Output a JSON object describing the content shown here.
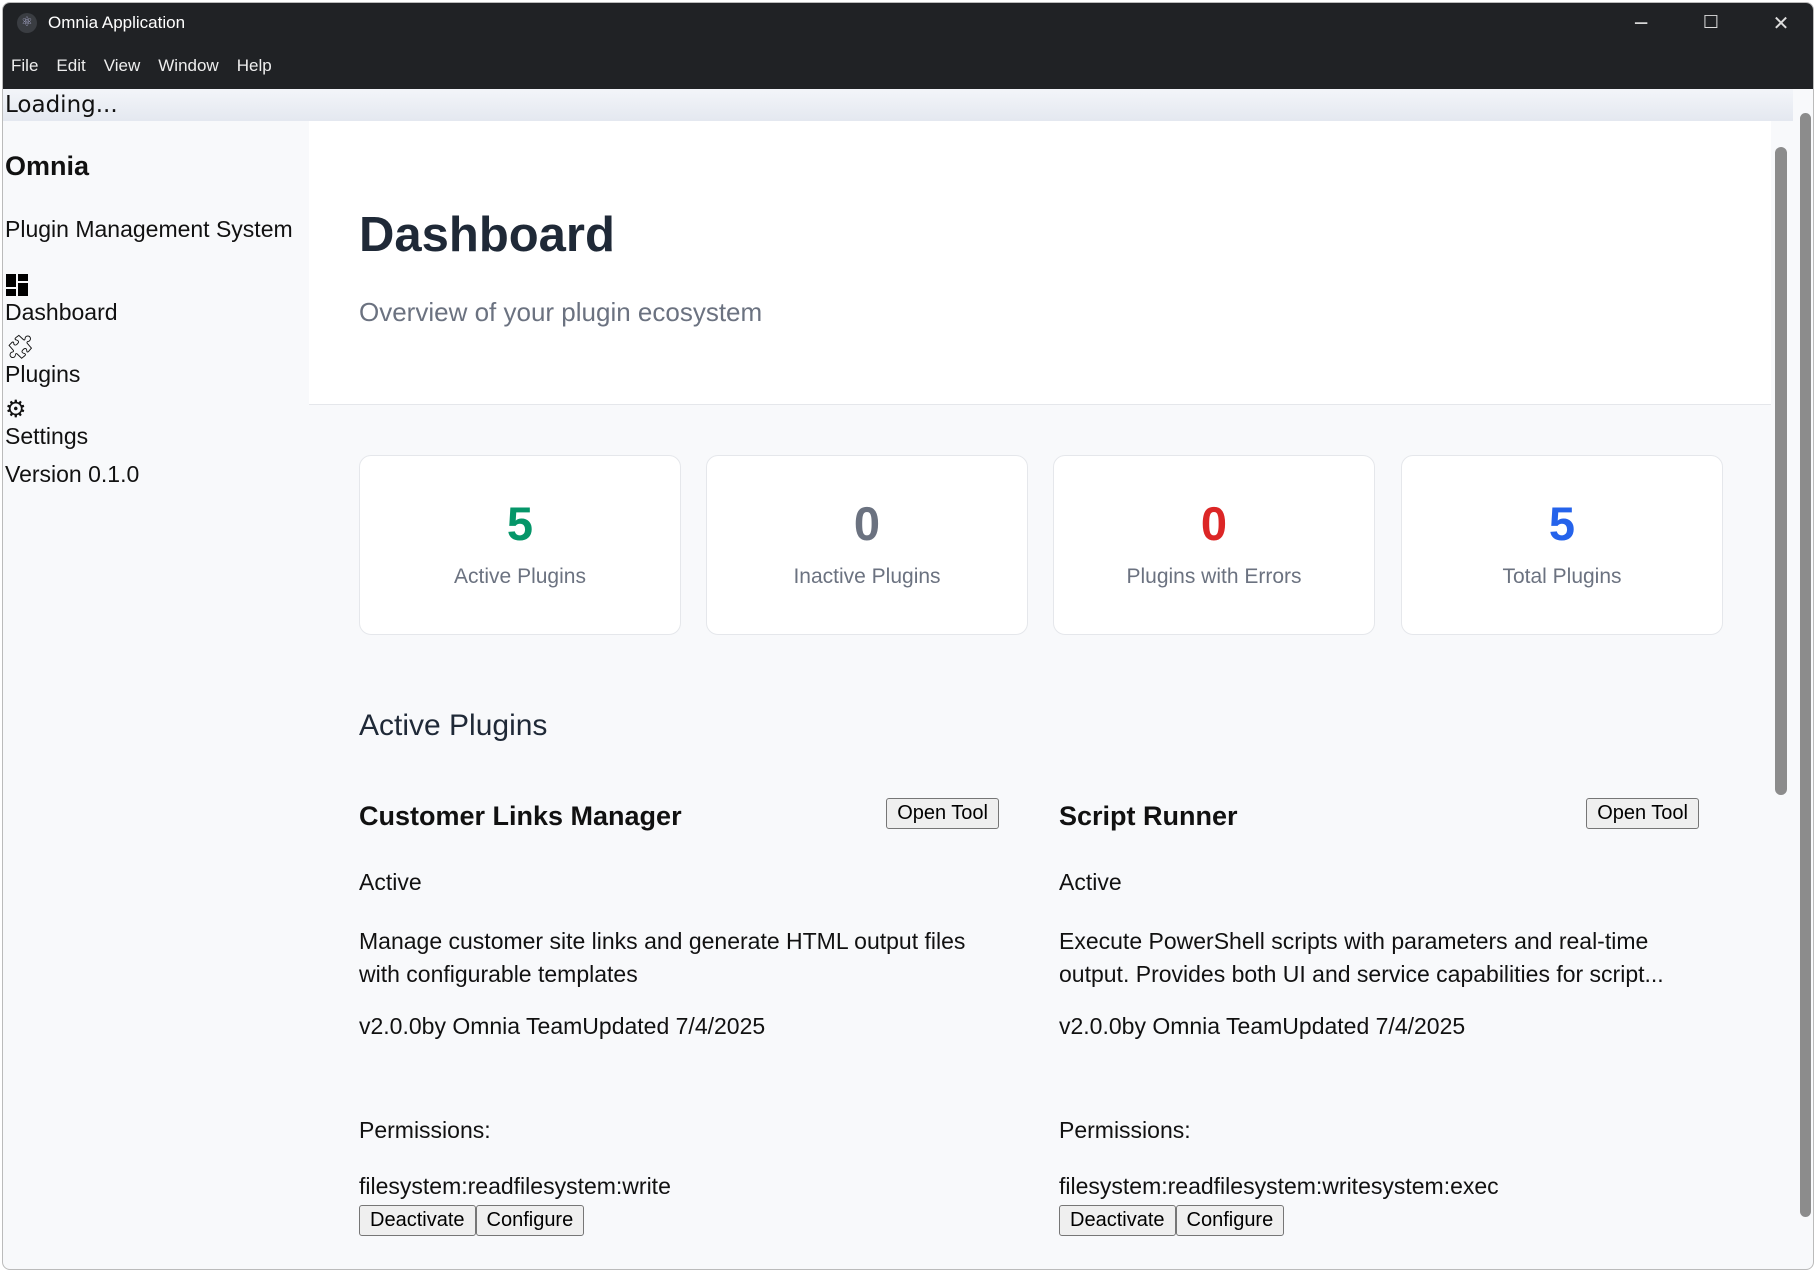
{
  "window": {
    "title": "Omnia Application",
    "minimize": "─",
    "maximize": "☐",
    "close": "✕"
  },
  "menu": [
    "File",
    "Edit",
    "View",
    "Window",
    "Help"
  ],
  "loading": "Loading...",
  "sidebar": {
    "brand": "Omnia",
    "subtitle": "Plugin Management System",
    "items": [
      {
        "label": "Dashboard",
        "icon": "dashboard-icon"
      },
      {
        "label": "Plugins",
        "icon": "puzzle-icon"
      },
      {
        "label": "Settings",
        "icon": "gear-icon"
      }
    ],
    "version": "Version 0.1.0"
  },
  "header": {
    "title": "Dashboard",
    "subtitle": "Overview of your plugin ecosystem"
  },
  "stats": [
    {
      "value": "5",
      "label": "Active Plugins",
      "color": "#059669"
    },
    {
      "value": "0",
      "label": "Inactive Plugins",
      "color": "#6b7280"
    },
    {
      "value": "0",
      "label": "Plugins with Errors",
      "color": "#dc2626"
    },
    {
      "value": "5",
      "label": "Total Plugins",
      "color": "#2563eb"
    }
  ],
  "section_title": "Active Plugins",
  "plugins": [
    {
      "name": "Customer Links Manager",
      "open": "Open Tool",
      "status": "Active",
      "description": "Manage customer site links and generate HTML output files with configurable templates",
      "meta": "v2.0.0by Omnia TeamUpdated 7/4/2025",
      "permissions_label": "Permissions:",
      "permissions": "filesystem:readfilesystem:write",
      "deactivate": "Deactivate",
      "configure": "Configure"
    },
    {
      "name": "Script Runner",
      "open": "Open Tool",
      "status": "Active",
      "description": "Execute PowerShell scripts with parameters and real-time output. Provides both UI and service capabilities for script...",
      "meta": "v2.0.0by Omnia TeamUpdated 7/4/2025",
      "permissions_label": "Permissions:",
      "permissions": "filesystem:readfilesystem:writesystem:exec",
      "deactivate": "Deactivate",
      "configure": "Configure"
    }
  ]
}
